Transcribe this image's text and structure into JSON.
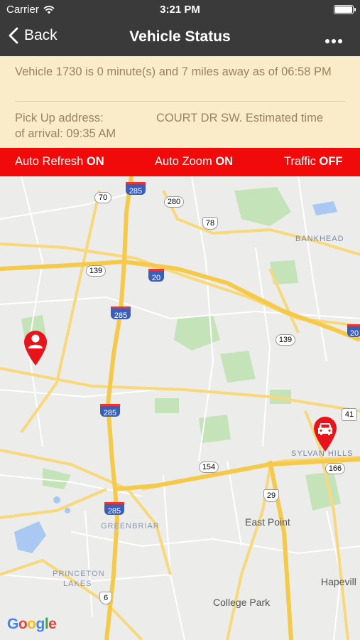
{
  "status_bar": {
    "carrier": "Carrier",
    "time": "3:21 PM",
    "wifi_icon": "wifi-icon",
    "battery_icon": "battery-icon"
  },
  "nav_bar": {
    "back_label": "Back",
    "title": "Vehicle Status",
    "more_icon": "ellipsis-icon"
  },
  "info_panel": {
    "vehicle_line": "Vehicle 1730 is 0 minute(s) and 7 miles away as of 06:58 PM",
    "pickup_label": "Pick Up address:",
    "pickup_address": "COURT DR SW. Estimated time",
    "eta": "of arrival: 09:35 AM"
  },
  "options_bar": {
    "auto_refresh_label": "Auto Refresh",
    "auto_refresh_value": "ON",
    "auto_zoom_label": "Auto Zoom",
    "auto_zoom_value": "ON",
    "traffic_label": "Traffic",
    "traffic_value": "OFF"
  },
  "map": {
    "route_shields": [
      "70",
      "285",
      "280",
      "78",
      "139",
      "20",
      "285",
      "139",
      "285",
      "154",
      "166",
      "29",
      "285",
      "41",
      "6",
      "20"
    ],
    "place_labels": [
      "BANKHEAD",
      "SYLVAN HILLS",
      "GREENBRIAR",
      "PRINCETON",
      "LAKES",
      "East Point",
      "College Park",
      "Hapevill"
    ],
    "attribution": "Google",
    "pickup_marker_icon": "person-pin-icon",
    "vehicle_marker_icon": "car-pin-icon"
  },
  "colors": {
    "header": "#3a3a3a",
    "info_bg": "#faebc9",
    "info_text": "#9a8460",
    "option_bar": "#f00a0a",
    "marker_red": "#e8141c"
  }
}
